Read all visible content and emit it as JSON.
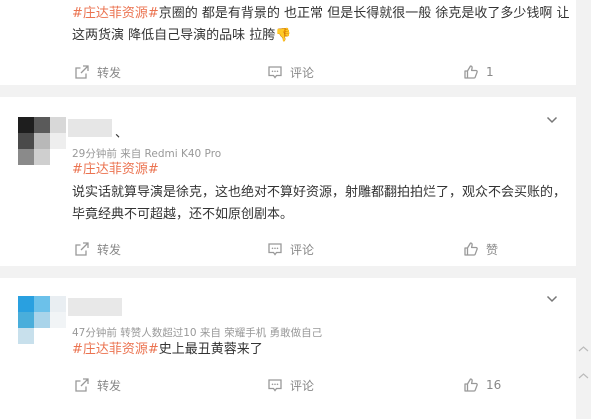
{
  "posts": [
    {
      "tag": "#庄达菲资源#",
      "text_line1": "京圈的 都是有背景的 也正常 但是长得就很一般 徐克是收了多少钱啊 让",
      "text_line2": "这两货演 降低自己导演的品味 拉胯",
      "emoji": "👎",
      "forward_label": "转发",
      "comment_label": "评论",
      "like_count": "1"
    },
    {
      "name": "、",
      "meta": "29分钟前  来自 Redmi K40 Pro",
      "tag": "#庄达菲资源#",
      "text_line1": "说实话就算导演是徐克，这也绝对不算好资源，射雕都翻拍拍烂了，观众不会买账的，",
      "text_line2": "毕竟经典不可超越，还不如原创剧本。",
      "forward_label": "转发",
      "comment_label": "评论",
      "like_label": "赞"
    },
    {
      "meta": "47分钟前  转赞人数超过10  来自 荣耀手机 勇敢做自己",
      "tag": "#庄达菲资源#",
      "text": "史上最丑黄蓉来了",
      "forward_label": "转发",
      "comment_label": "评论",
      "like_count": "16"
    }
  ],
  "icons": {
    "forward": "share-icon",
    "comment": "comment-icon",
    "like": "thumb-up-icon",
    "menu": "chevron-down-icon"
  },
  "colors": {
    "tag": "#eb7350",
    "meta": "#999999",
    "action": "#888888"
  }
}
